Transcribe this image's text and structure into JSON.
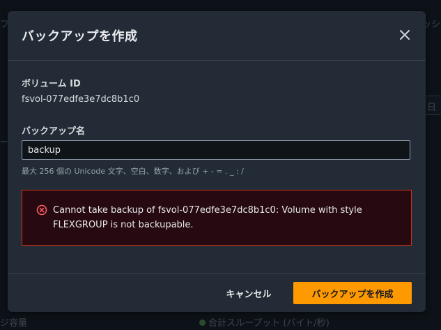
{
  "background": {
    "fragment_left": "フ",
    "fragment_right": "ッシ",
    "fragment_date": "日",
    "fragment_mid": "ー:",
    "fragment_bottom_left": "ジ容量",
    "fragment_bottom_status": "合計スループット (バイト/秒)"
  },
  "dialog": {
    "title": "バックアップを作成",
    "volume_id_label": "ボリューム ID",
    "volume_id_value": "fsvol-077edfe3e7dc8b1c0",
    "backup_name_label": "バックアップ名",
    "backup_name_value": "backup",
    "backup_name_hint": "最大 256 個の Unicode 文字、空白、数字、および + - = . _ : /",
    "error_message": "Cannot take backup of fsvol-077edfe3e7dc8b1c0: Volume with style FLEXGROUP is not backupable.",
    "cancel_label": "キャンセル",
    "submit_label": "バックアップを作成"
  },
  "colors": {
    "accent": "#ff9900",
    "error_border": "#d13212",
    "error_bg": "#270a11",
    "modal_bg": "#232b36"
  },
  "icons": {
    "close": "close-icon",
    "error": "error-circle-icon"
  }
}
